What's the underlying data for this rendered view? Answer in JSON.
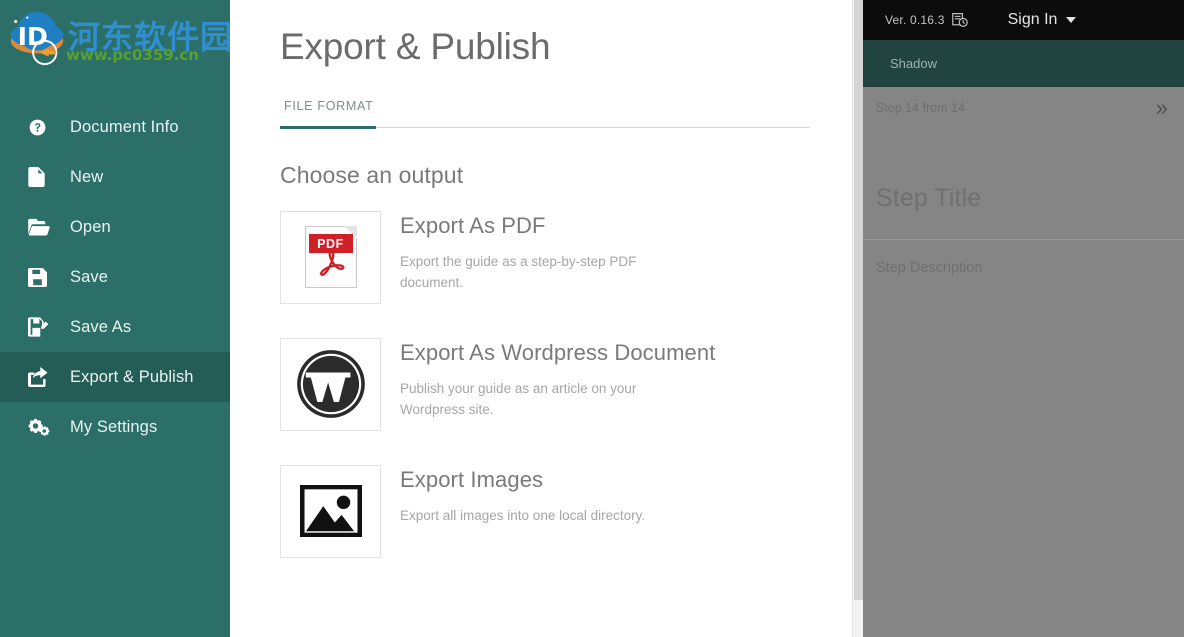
{
  "colors": {
    "sidebar_bg": "#2b6f68",
    "sidebar_active_bg": "#245c56",
    "accent_teal": "#2b6f68",
    "panel_gray": "#858585",
    "topbar_black": "#0c0c0c",
    "shadow_bar": "#21443f",
    "pdf_red": "#cf2027",
    "brand_blue": "#2f8fd0",
    "brand_green": "#5aa02c"
  },
  "sidebar": {
    "brand": {
      "logo_icon": "globe-arrow-logo",
      "name_cn": "河东软件园",
      "url": "www.pc0359.cn"
    },
    "items": [
      {
        "label": "Document Info",
        "icon": "question-circle-icon",
        "active": false
      },
      {
        "label": "New",
        "icon": "document-icon",
        "active": false
      },
      {
        "label": "Open",
        "icon": "folder-open-icon",
        "active": false
      },
      {
        "label": "Save",
        "icon": "floppy-disk-icon",
        "active": false
      },
      {
        "label": "Save As",
        "icon": "floppy-disk-pencil-icon",
        "active": false
      },
      {
        "label": "Export & Publish",
        "icon": "share-export-icon",
        "active": true
      },
      {
        "label": "My Settings",
        "icon": "gears-icon",
        "active": false
      }
    ]
  },
  "main": {
    "page_title": "Export & Publish",
    "tabs": [
      {
        "label": "FILE FORMAT",
        "active": true
      }
    ],
    "section_title": "Choose an output",
    "options": [
      {
        "title": "Export As PDF",
        "description": "Export the guide as a step-by-step PDF document.",
        "icon": "pdf-file-icon",
        "badge_text": "PDF"
      },
      {
        "title": "Export As Wordpress Document",
        "description": "Publish your guide as an article on your Wordpress site.",
        "icon": "wordpress-icon"
      },
      {
        "title": "Export Images",
        "description": "Export all images into one local directory.",
        "icon": "image-icon"
      }
    ]
  },
  "right_panel": {
    "version_label": "Ver. 0.16.3",
    "version_icon": "version-history-icon",
    "sign_in_label": "Sign In",
    "sign_in_caret": "chevron-down-icon",
    "shadow_label": "Shadow",
    "step_counter": "Step 14 from 14",
    "expand_icon": "double-chevron-right-icon",
    "expand_glyph": "»",
    "step_title_placeholder": "Step Title",
    "step_description_placeholder": "Step Description"
  }
}
